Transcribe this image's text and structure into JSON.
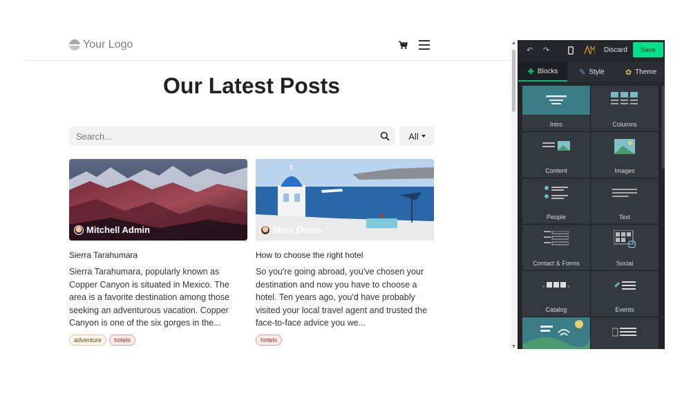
{
  "site": {
    "logo_text": "Your Logo",
    "page_title": "Our Latest Posts",
    "search_placeholder": "Search...",
    "filter_label": "All",
    "posts": [
      {
        "author": "Mitchell Admin",
        "title": "Sierra Tarahumara",
        "excerpt": "Sierra Tarahumara, popularly known as Copper Canyon is situated in Mexico. The area is a favorite destination among those seeking an adventurous vacation. Copper Canyon is one of the six gorges in the...",
        "tags": [
          "adventure",
          "hotels"
        ]
      },
      {
        "author": "Marc Demo",
        "title": "How to choose the right hotel",
        "excerpt": "So you're going abroad, you've chosen your destination and now you have to choose a hotel. Ten years ago, you'd have probably visited your local travel agent and trusted the face-to-face advice you we...",
        "tags": [
          "hotels"
        ]
      }
    ]
  },
  "editor": {
    "discard_label": "Discard",
    "save_label": "Save",
    "tabs": [
      {
        "label": "Blocks",
        "icon": "plus-icon"
      },
      {
        "label": "Style",
        "icon": "brush-icon"
      },
      {
        "label": "Theme",
        "icon": "gear-icon"
      }
    ],
    "blocks": [
      {
        "label": "Intro",
        "icon": "intro-icon"
      },
      {
        "label": "Columns",
        "icon": "columns-icon"
      },
      {
        "label": "Content",
        "icon": "content-icon"
      },
      {
        "label": "Images",
        "icon": "images-icon"
      },
      {
        "label": "People",
        "icon": "people-icon"
      },
      {
        "label": "Text",
        "icon": "text-icon"
      },
      {
        "label": "Contact & Forms",
        "icon": "form-icon"
      },
      {
        "label": "Social",
        "icon": "social-icon"
      },
      {
        "label": "Catalog",
        "icon": "catalog-icon"
      },
      {
        "label": "Events",
        "icon": "events-icon"
      },
      {
        "label": "",
        "icon": "landscape-icon"
      },
      {
        "label": "",
        "icon": "list-icon"
      }
    ]
  }
}
